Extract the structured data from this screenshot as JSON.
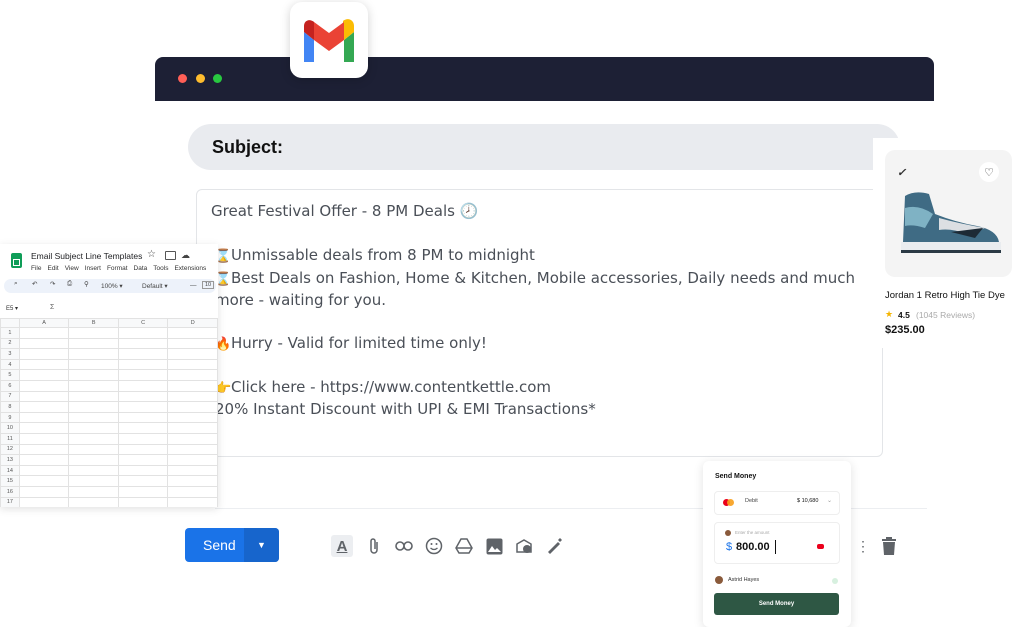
{
  "gmail": {
    "icon": "gmail-logo-icon"
  },
  "compose": {
    "subject_label": "Subject:",
    "body_lines": [
      {
        "emoji": "",
        "text": "Great Festival Offer - 8 PM Deals 🕗"
      },
      {
        "emoji": "⌛",
        "text": "Unmissable deals from 8 PM to midnight"
      },
      {
        "emoji": "⌛",
        "text": "Best Deals on Fashion, Home & Kitchen, Mobile accessories, Daily needs and much"
      },
      {
        "emoji": "",
        "text": "more - waiting for you."
      },
      {
        "emoji": "🔥",
        "text": "Hurry - Valid for limited time only!"
      },
      {
        "emoji": "👉",
        "text": "Click here - https://www.contentkettle.com"
      },
      {
        "emoji": "",
        "text": "20% Instant Discount with UPI & EMI Transactions*"
      }
    ],
    "send_label": "Send"
  },
  "sheet": {
    "title": "Email Subject Line Templates",
    "menu": [
      "File",
      "Edit",
      "View",
      "Insert",
      "Format",
      "Data",
      "Tools",
      "Extensions"
    ],
    "zoom": "100%",
    "font": "Default",
    "font_size": "10",
    "cell_ref": "E5",
    "columns": [
      "A",
      "B",
      "C",
      "D"
    ],
    "rows": [
      "1",
      "2",
      "3",
      "4",
      "5",
      "6",
      "7",
      "8",
      "9",
      "10",
      "11",
      "12",
      "13",
      "14",
      "15",
      "16",
      "17"
    ]
  },
  "product": {
    "name": "Jordan 1 Retro High Tie Dye",
    "rating": "4.5",
    "reviews": "(1045 Reviews)",
    "price": "$235.00"
  },
  "money": {
    "title": "Send Money",
    "card_label": "Debit",
    "balance": "$ 10,680",
    "amount_placeholder": "Enter the amount",
    "amount": "800.00",
    "currency": "$",
    "recipient": "Astrid Hayes",
    "button": "Send Money"
  },
  "colors": {
    "titlebar": "#1d2035",
    "send": "#1a73e8",
    "money_button": "#2e5744"
  }
}
